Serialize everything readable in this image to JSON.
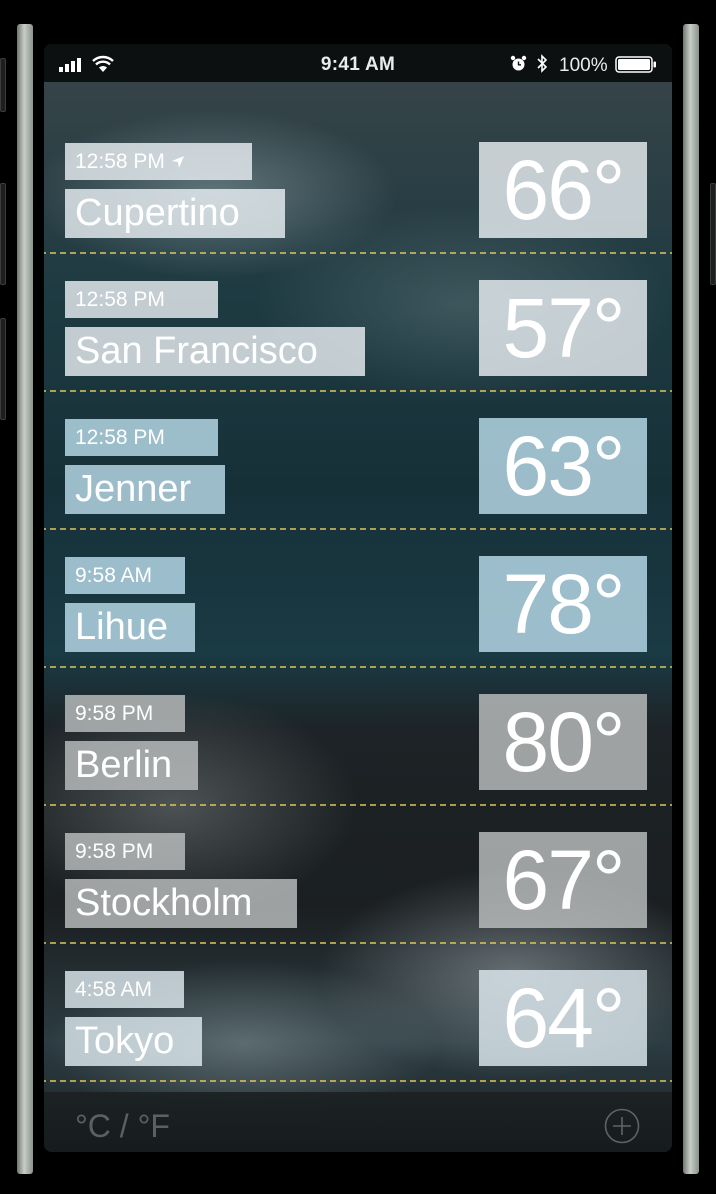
{
  "status_bar": {
    "time": "9:41 AM",
    "battery": "100%"
  },
  "cities": [
    {
      "time": "12:58 PM",
      "name": "Cupertino",
      "temp": "66°",
      "current_location": true,
      "highlight": "#e8eef2",
      "highlight_opacity": 0.82
    },
    {
      "time": "12:58 PM",
      "name": "San Francisco",
      "temp": "57°",
      "current_location": false,
      "highlight": "#e8eef2",
      "highlight_opacity": 0.82
    },
    {
      "time": "12:58 PM",
      "name": "Jenner",
      "temp": "63°",
      "current_location": false,
      "highlight": "#b9dcea",
      "highlight_opacity": 0.82
    },
    {
      "time": "9:58 AM",
      "name": "Lihue",
      "temp": "78°",
      "current_location": false,
      "highlight": "#b9dcea",
      "highlight_opacity": 0.82
    },
    {
      "time": "9:58 PM",
      "name": "Berlin",
      "temp": "80°",
      "current_location": false,
      "highlight": "#bcbebe",
      "highlight_opacity": 0.82
    },
    {
      "time": "9:58 PM",
      "name": "Stockholm",
      "temp": "67°",
      "current_location": false,
      "highlight": "#bcbebe",
      "highlight_opacity": 0.82
    },
    {
      "time": "4:58 AM",
      "name": "Tokyo",
      "temp": "64°",
      "current_location": false,
      "highlight": "#dde9ef",
      "highlight_opacity": 0.82
    }
  ],
  "footer": {
    "unit_toggle": "°C / °F"
  },
  "icons": {
    "location": "location-arrow-icon",
    "add": "plus-circle-icon"
  },
  "colors": {
    "separator": "#dcc85a",
    "status_bar": "#0d1011"
  }
}
